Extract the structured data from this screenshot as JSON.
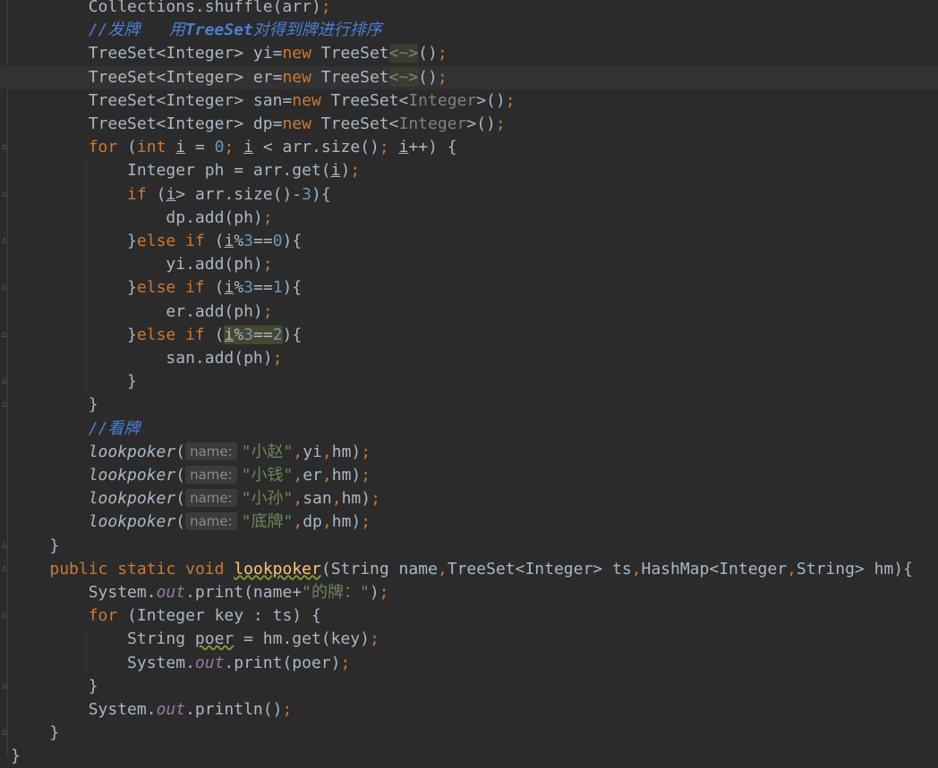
{
  "editor": {
    "lines": [
      "        Collections.shuffle(arr);",
      "        //发牌   用TreeSet对得到牌进行排序",
      "        TreeSet<Integer> yi=new TreeSet<~>();",
      "        TreeSet<Integer> er=new TreeSet<~>();",
      "        TreeSet<Integer> san=new TreeSet<Integer>();",
      "        TreeSet<Integer> dp=new TreeSet<Integer>();",
      "        for (int i = 0; i < arr.size(); i++) {",
      "            Integer ph = arr.get(i);",
      "            if (i> arr.size()-3){",
      "                dp.add(ph);",
      "            }else if (i%3==0){",
      "                yi.add(ph);",
      "            }else if (i%3==1){",
      "                er.add(ph);",
      "            }else if (i%3==2){",
      "                san.add(ph);",
      "            }",
      "        }",
      "        //看牌",
      "        lookpoker( name: \"小赵\",yi,hm);",
      "        lookpoker( name: \"小钱\",er,hm);",
      "        lookpoker( name: \"小孙\",san,hm);",
      "        lookpoker( name: \"底牌\",dp,hm);",
      "    }",
      "    public static void lookpoker(String name,TreeSet<Integer> ts,HashMap<Integer,String> hm){",
      "        System.out.print(name+\"的牌：\");",
      "        for (Integer key : ts) {",
      "            String poer = hm.get(key);",
      "            System.out.print(poer);",
      "        }",
      "        System.out.println();",
      "    }",
      "}"
    ],
    "param_hint": "name:",
    "names": [
      "小赵",
      "小钱",
      "小孙",
      "底牌"
    ]
  }
}
